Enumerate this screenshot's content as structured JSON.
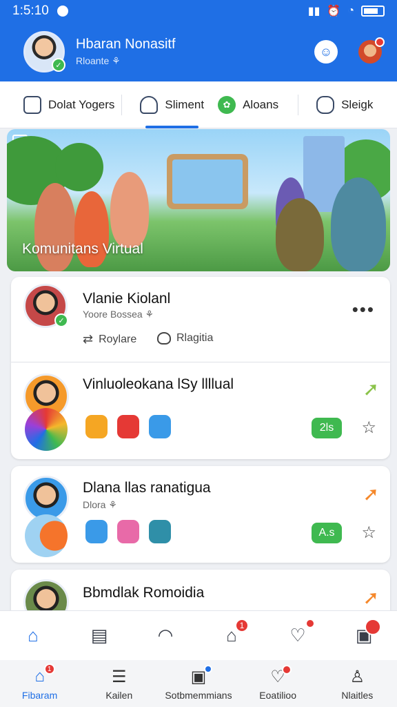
{
  "status": {
    "time": "1:5:10"
  },
  "header": {
    "title": "Hbaran Nonasitf",
    "subtitle": "Rloante ⚘",
    "chat_icon": "chat-bubble-icon",
    "profile_icon": "profile-avatar-icon"
  },
  "tabs": [
    {
      "label": "Dolat Yogers",
      "icon": "home-outline-icon"
    },
    {
      "label": "Sliment",
      "icon": "person-outline-icon"
    },
    {
      "label": "Aloans",
      "icon": "chat-leaf-icon"
    },
    {
      "label": "Sleigk",
      "icon": "group-outline-icon"
    }
  ],
  "banner": {
    "caption": "Komunitans Virtual"
  },
  "feed": {
    "top_post": {
      "name": "Vlanie Kiolanl",
      "meta": "Yoore Bossea ⚘",
      "action_repost": "Roylare",
      "action_like": "Rlagitia"
    },
    "items": [
      {
        "title": "Vinluoleokana lSy llllual",
        "pill": "2ls",
        "arrow_color": "#8bc34a"
      },
      {
        "title": "Dlana llas ranatigua",
        "meta": "Dlora ⚘",
        "pill": "A.s",
        "arrow_color": "#f5882b"
      },
      {
        "title": "Bbmdlak Romoidia",
        "meta": "",
        "arrow_color": "#f5882b"
      }
    ]
  },
  "secondary_nav": {
    "icons": [
      "home-icon",
      "newspaper-icon",
      "rainbow-icon",
      "house-notification-icon",
      "heart-icon",
      "media-icon"
    ],
    "badges": {
      "house": "1"
    }
  },
  "bottom_nav": [
    {
      "label": "Fibaram",
      "icon": "home-icon",
      "badge": "1"
    },
    {
      "label": "Kailen",
      "icon": "list-icon"
    },
    {
      "label": "Sotbmemmians",
      "icon": "speaker-icon"
    },
    {
      "label": "Eoatilioo",
      "icon": "heart-chat-icon"
    },
    {
      "label": "Nlaitles",
      "icon": "user-icon"
    }
  ],
  "colors": {
    "primary": "#1f6fe5",
    "success": "#3fb950",
    "alert": "#e53935"
  }
}
